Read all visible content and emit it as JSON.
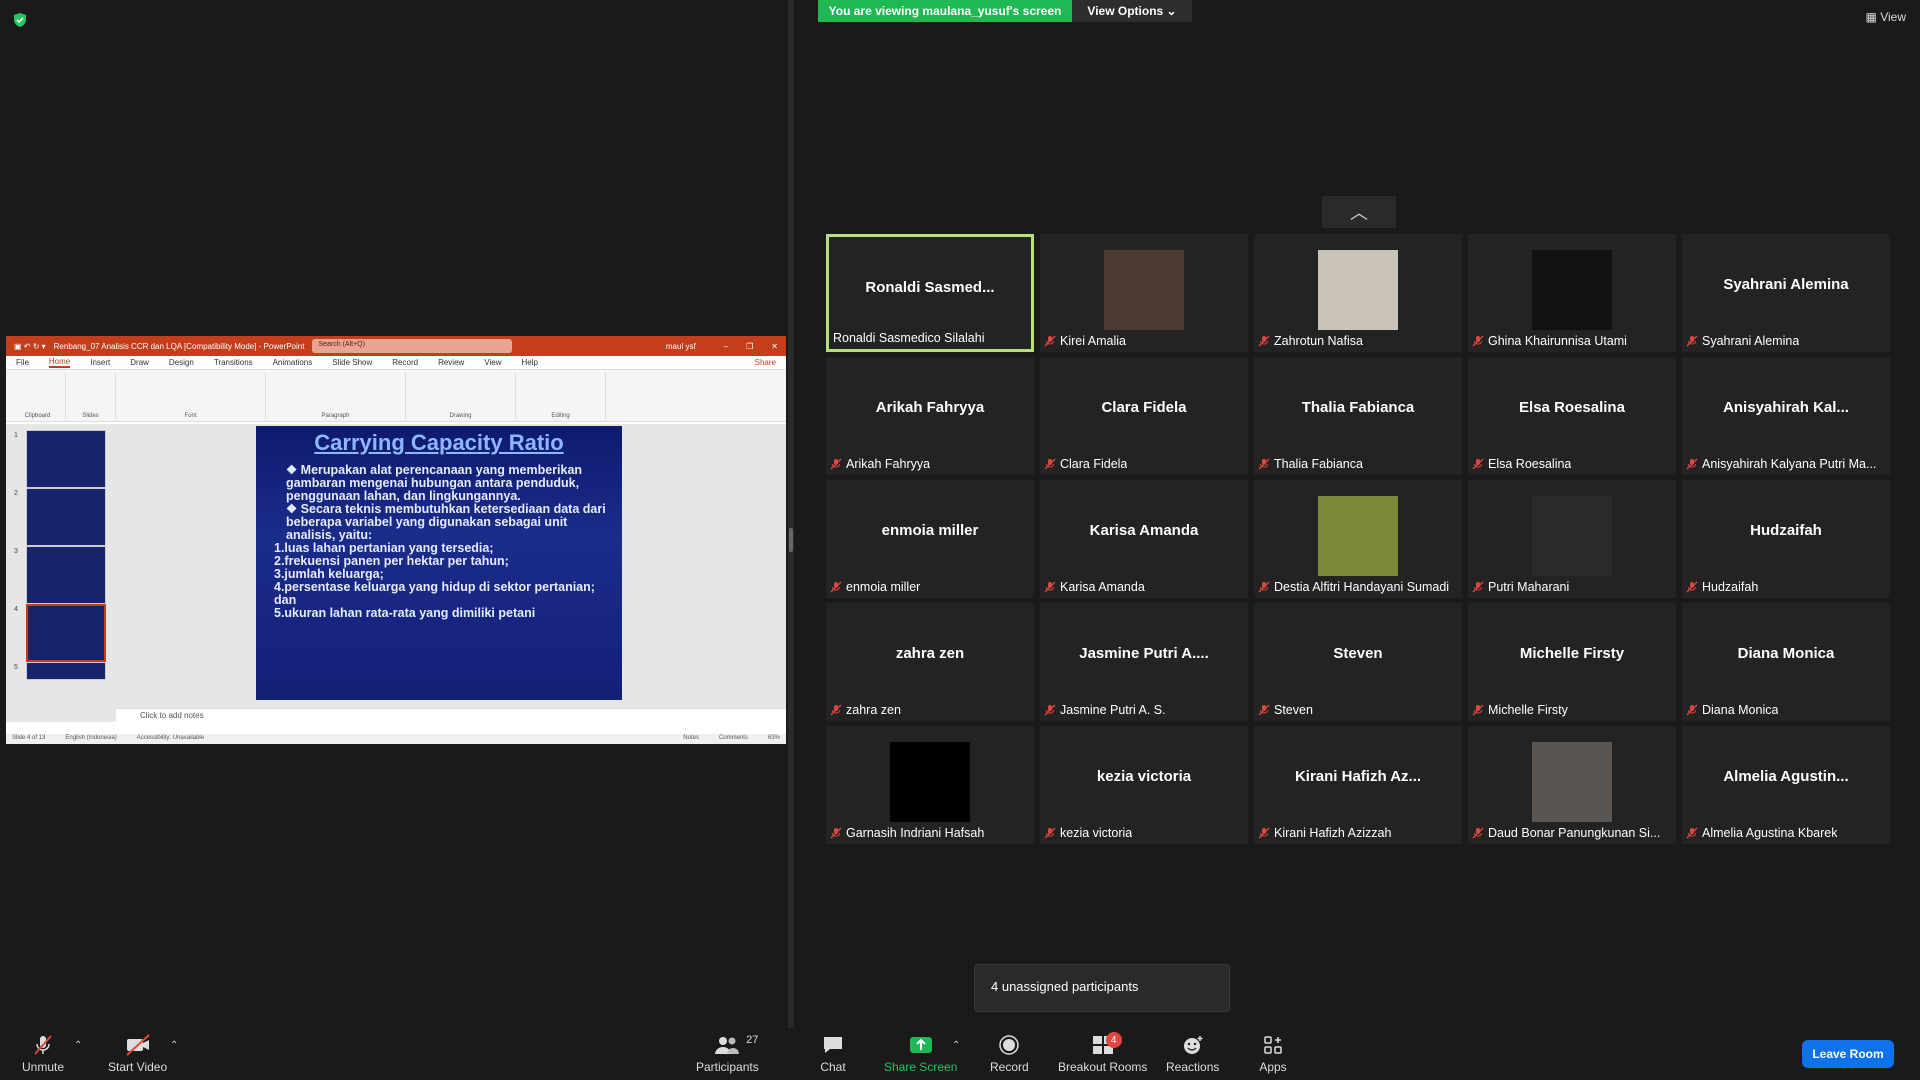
{
  "banner": {
    "viewing": "You are viewing maulana_yusuf's screen",
    "view_options": "View Options",
    "view": "View"
  },
  "powerpoint": {
    "title": "Renbang_07 Analisis CCR dan LQA [Compatibility Mode] - PowerPoint",
    "search": "Search (Alt+Q)",
    "user": "maul ysf",
    "menu": [
      "File",
      "Home",
      "Insert",
      "Draw",
      "Design",
      "Transitions",
      "Animations",
      "Slide Show",
      "Record",
      "Review",
      "View",
      "Help"
    ],
    "share": "Share",
    "ribbon_groups": [
      "Clipboard",
      "Slides",
      "Font",
      "Paragraph",
      "Drawing",
      "Editing"
    ],
    "slide_title": "Carrying Capacity Ratio",
    "slide_bullets": [
      "❖ Merupakan alat perencanaan yang memberikan gambaran mengenai hubungan antara penduduk, penggunaan lahan, dan lingkungannya.",
      "❖ Secara teknis membutuhkan ketersediaan data dari beberapa variabel yang digunakan sebagai unit analisis, yaitu:",
      "1.luas lahan pertanian yang tersedia;",
      "2.frekuensi panen per hektar per tahun;",
      "3.jumlah keluarga;",
      "4.persentase keluarga yang hidup di sektor pertanian; dan",
      "5.ukuran lahan rata-rata yang dimiliki petani"
    ],
    "thumb_nums": [
      "1",
      "2",
      "3",
      "4",
      "5"
    ],
    "notes": "Click to add notes",
    "status": [
      "Slide 4 of 13",
      "English (Indonesia)",
      "Accessibility: Unavailable",
      "Notes",
      "Comments",
      "63%"
    ]
  },
  "participants": [
    {
      "big": "Ronaldi  Sasmed...",
      "label": "Ronaldi Sasmedico Silalahi",
      "muted": false,
      "photo": false,
      "active": true
    },
    {
      "big": "",
      "label": "Kirei Amalia",
      "muted": true,
      "photo": true,
      "photo_color": "#4a3a30"
    },
    {
      "big": "",
      "label": "Zahrotun Nafisa",
      "muted": true,
      "photo": true,
      "photo_color": "#c8c2b8"
    },
    {
      "big": "",
      "label": "Ghina Khairunnisa Utami",
      "muted": true,
      "photo": true,
      "photo_color": "#111111"
    },
    {
      "big": "Syahrani Alemina",
      "label": "Syahrani Alemina",
      "muted": true,
      "photo": false
    },
    {
      "big": "Arikah Fahryya",
      "label": "Arikah Fahryya",
      "muted": true,
      "photo": false
    },
    {
      "big": "Clara Fidela",
      "label": "Clara Fidela",
      "muted": true,
      "photo": false
    },
    {
      "big": "Thalia Fabianca",
      "label": "Thalia Fabianca",
      "muted": true,
      "photo": false
    },
    {
      "big": "Elsa Roesalina",
      "label": "Elsa Roesalina",
      "muted": true,
      "photo": false
    },
    {
      "big": "Anisyahirah  Kal...",
      "label": "Anisyahirah Kalyana Putri Ma...",
      "muted": true,
      "photo": false
    },
    {
      "big": "enmoia miller",
      "label": "enmoia miller",
      "muted": true,
      "photo": false
    },
    {
      "big": "Karisa Amanda",
      "label": "Karisa Amanda",
      "muted": true,
      "photo": false
    },
    {
      "big": "",
      "label": "Destia Alfitri Handayani Sumadi",
      "muted": true,
      "photo": true,
      "photo_color": "#7a8a3a"
    },
    {
      "big": "",
      "label": "Putri Maharani",
      "muted": true,
      "photo": true,
      "photo_color": "#2a2a2a"
    },
    {
      "big": "Hudzaifah",
      "label": "Hudzaifah",
      "muted": true,
      "photo": false
    },
    {
      "big": "zahra zen",
      "label": "zahra zen",
      "muted": true,
      "photo": false
    },
    {
      "big": "Jasmine  Putri  A....",
      "label": "Jasmine Putri A. S.",
      "muted": true,
      "photo": false
    },
    {
      "big": "Steven",
      "label": "Steven",
      "muted": true,
      "photo": false
    },
    {
      "big": "Michelle Firsty",
      "label": "Michelle Firsty",
      "muted": true,
      "photo": false
    },
    {
      "big": "Diana Monica",
      "label": "Diana Monica",
      "muted": true,
      "photo": false
    },
    {
      "big": "",
      "label": "Garnasih Indriani Hafsah",
      "muted": true,
      "photo": true,
      "photo_color": "#000000"
    },
    {
      "big": "kezia victoria",
      "label": "kezia victoria",
      "muted": true,
      "photo": false
    },
    {
      "big": "Kirani  Hafizh  Az...",
      "label": "Kirani Hafizh Azizzah",
      "muted": true,
      "photo": false
    },
    {
      "big": "",
      "label": "Daud Bonar Panungkunan Si...",
      "muted": true,
      "photo": true,
      "photo_color": "#5a5550"
    },
    {
      "big": "Almelia  Agustin...",
      "label": "Almelia Agustina Kbarek",
      "muted": true,
      "photo": false
    }
  ],
  "popup": "4 unassigned participants",
  "toolbar": {
    "unmute": "Unmute",
    "start_video": "Start Video",
    "participants": "Participants",
    "participant_count": "27",
    "chat": "Chat",
    "share_screen": "Share Screen",
    "record": "Record",
    "breakout": "Breakout Rooms",
    "breakout_badge": "4",
    "reactions": "Reactions",
    "apps": "Apps",
    "leave": "Leave Room"
  },
  "colors": {
    "accent_green": "#1fb854",
    "active_border": "#b7e07a",
    "leave_blue": "#0e72ed",
    "mute_red": "#e0463f",
    "ppt_red": "#c43e1c"
  }
}
